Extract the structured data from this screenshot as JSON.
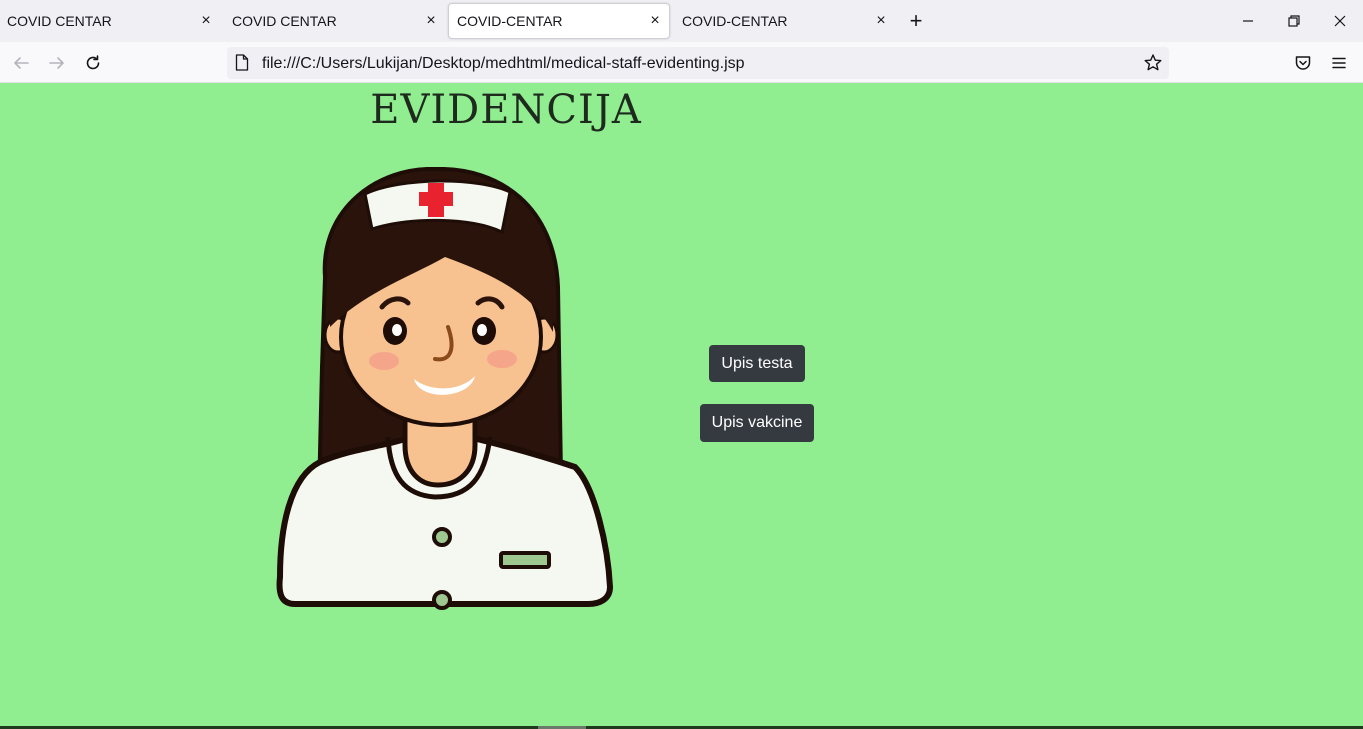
{
  "browser": {
    "tabs": [
      {
        "label": "COVID CENTAR",
        "active": false
      },
      {
        "label": "COVID CENTAR",
        "active": false
      },
      {
        "label": "COVID-CENTAR",
        "active": true
      },
      {
        "label": "COVID-CENTAR",
        "active": false
      }
    ],
    "tab_close_glyph": "×",
    "new_tab_glyph": "+",
    "url": "file:///C:/Users/Lukijan/Desktop/medhtml/medical-staff-evidenting.jsp",
    "icons": [
      "back-arrow-icon",
      "forward-arrow-icon",
      "reload-icon",
      "page-icon",
      "bookmark-star-icon",
      "pocket-icon",
      "menu-icon",
      "minimize-icon",
      "restore-icon",
      "close-window-icon"
    ]
  },
  "page": {
    "title": "EVIDENCIJA",
    "buttons": {
      "test_entry": "Upis testa",
      "vaccine_entry": "Upis vakcine"
    },
    "background_color": "#90ee90",
    "button_color": "#343a40",
    "image": "nurse-illustration"
  }
}
